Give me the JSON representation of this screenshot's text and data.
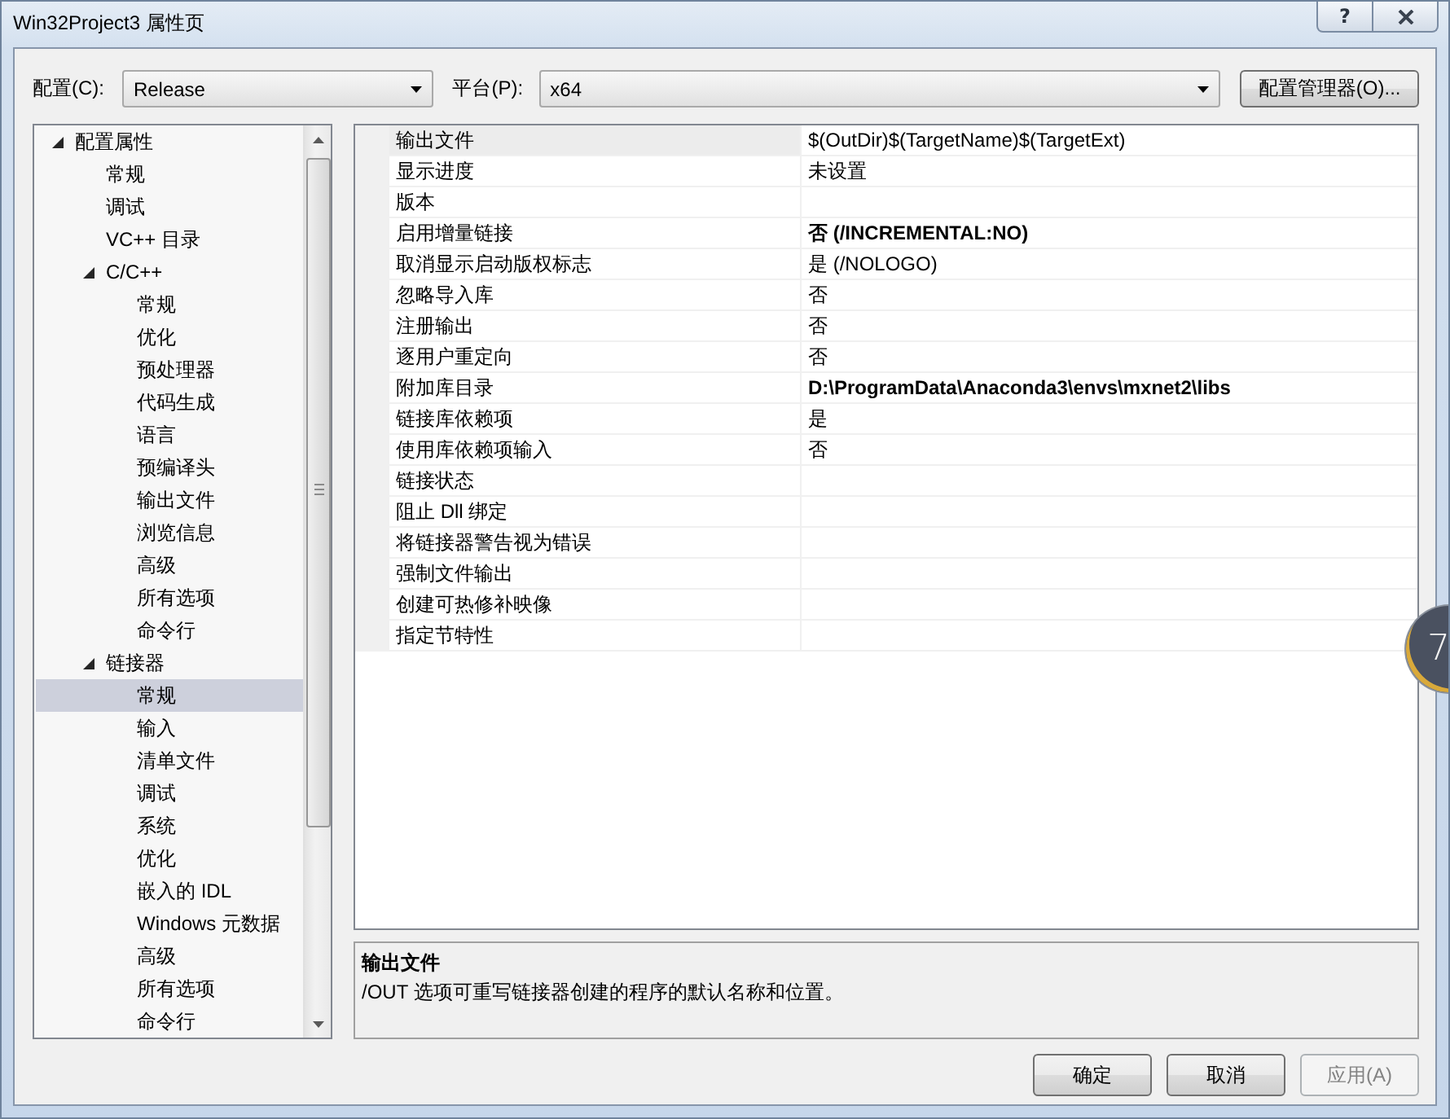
{
  "window": {
    "title": "Win32Project3 属性页",
    "help": "?"
  },
  "config_bar": {
    "configuration": {
      "label": "配置(C):",
      "value": "Release"
    },
    "platform": {
      "label": "平台(P):",
      "value": "x64"
    },
    "manager_button": "配置管理器(O)..."
  },
  "tree": {
    "items": [
      {
        "label": "配置属性",
        "expanded": true,
        "selected": false,
        "children": [
          {
            "label": "常规",
            "selected": false
          },
          {
            "label": "调试",
            "selected": false
          },
          {
            "label": "VC++ 目录",
            "selected": false
          },
          {
            "label": "C/C++",
            "expanded": true,
            "selected": false,
            "children": [
              {
                "label": "常规",
                "selected": false
              },
              {
                "label": "优化",
                "selected": false
              },
              {
                "label": "预处理器",
                "selected": false
              },
              {
                "label": "代码生成",
                "selected": false
              },
              {
                "label": "语言",
                "selected": false
              },
              {
                "label": "预编译头",
                "selected": false
              },
              {
                "label": "输出文件",
                "selected": false
              },
              {
                "label": "浏览信息",
                "selected": false
              },
              {
                "label": "高级",
                "selected": false
              },
              {
                "label": "所有选项",
                "selected": false
              },
              {
                "label": "命令行",
                "selected": false
              }
            ]
          },
          {
            "label": "链接器",
            "expanded": true,
            "selected": false,
            "children": [
              {
                "label": "常规",
                "selected": true
              },
              {
                "label": "输入",
                "selected": false
              },
              {
                "label": "清单文件",
                "selected": false
              },
              {
                "label": "调试",
                "selected": false
              },
              {
                "label": "系统",
                "selected": false
              },
              {
                "label": "优化",
                "selected": false
              },
              {
                "label": "嵌入的 IDL",
                "selected": false
              },
              {
                "label": "Windows 元数据",
                "selected": false
              },
              {
                "label": "高级",
                "selected": false
              },
              {
                "label": "所有选项",
                "selected": false
              },
              {
                "label": "命令行",
                "selected": false
              }
            ]
          }
        ]
      }
    ]
  },
  "properties": {
    "rows": [
      {
        "name": "输出文件",
        "value": "$(OutDir)$(TargetName)$(TargetExt)",
        "modified": false,
        "selected": true
      },
      {
        "name": "显示进度",
        "value": "未设置",
        "modified": false,
        "selected": false
      },
      {
        "name": "版本",
        "selected": false
      },
      {
        "name": "启用增量链接",
        "value": "否 (/INCREMENTAL:NO)",
        "modified": true,
        "selected": false
      },
      {
        "name": "取消显示启动版权标志",
        "value": "是 (/NOLOGO)",
        "modified": false,
        "selected": false
      },
      {
        "name": "忽略导入库",
        "value": "否",
        "modified": false,
        "selected": false
      },
      {
        "name": "注册输出",
        "value": "否",
        "modified": false,
        "selected": false
      },
      {
        "name": "逐用户重定向",
        "value": "否",
        "modified": false,
        "selected": false
      },
      {
        "name": "附加库目录",
        "value": "D:\\ProgramData\\Anaconda3\\envs\\mxnet2\\libs",
        "modified": true,
        "selected": false
      },
      {
        "name": "链接库依赖项",
        "value": "是",
        "modified": false,
        "selected": false
      },
      {
        "name": "使用库依赖项输入",
        "value": "否",
        "modified": false,
        "selected": false
      },
      {
        "name": "链接状态",
        "selected": false
      },
      {
        "name": "阻止 Dll 绑定",
        "selected": false
      },
      {
        "name": "将链接器警告视为错误",
        "selected": false
      },
      {
        "name": "强制文件输出",
        "selected": false
      },
      {
        "name": "创建可热修补映像",
        "selected": false
      },
      {
        "name": "指定节特性",
        "selected": false
      }
    ]
  },
  "description": {
    "title": "输出文件",
    "text": "/OUT 选项可重写链接器创建的程序的默认名称和位置。"
  },
  "buttons": [
    {
      "label": "确定",
      "disabled": false
    },
    {
      "label": "取消",
      "disabled": false
    },
    {
      "label": "应用(A)",
      "disabled": true
    }
  ],
  "floating_badge": {
    "text": "7"
  }
}
